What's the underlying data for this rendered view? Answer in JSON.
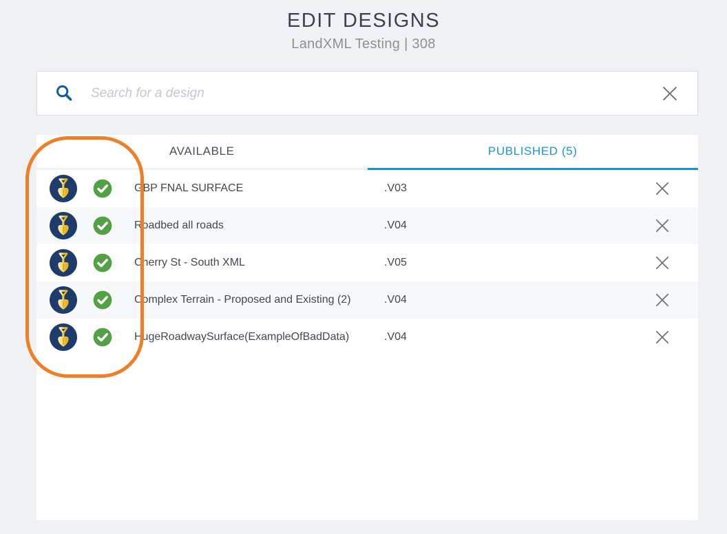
{
  "header": {
    "title": "EDIT DESIGNS",
    "subtitle": "LandXML Testing | 308"
  },
  "search": {
    "placeholder": "Search for a design",
    "value": ""
  },
  "tabs": [
    {
      "label": "AVAILABLE",
      "active": false
    },
    {
      "label": "PUBLISHED (5)",
      "active": true
    }
  ],
  "designs": [
    {
      "name": "GBP FNAL SURFACE",
      "version": ".V03",
      "status": "published"
    },
    {
      "name": "Roadbed all roads",
      "version": ".V04",
      "status": "published"
    },
    {
      "name": "Cherry St - South XML",
      "version": ".V05",
      "status": "published"
    },
    {
      "name": "Complex Terrain - Proposed and Existing (2)",
      "version": ".V04",
      "status": "published"
    },
    {
      "name": "HugeRoadwaySurface(ExampleOfBadData)",
      "version": ".V04",
      "status": "published"
    }
  ],
  "icons": {
    "search": "magnifying-glass",
    "clear_search": "x-mark",
    "design_type": "shovel-circle",
    "published_status": "check-circle",
    "remove_row": "x-mark"
  },
  "colors": {
    "accent_blue": "#1898d6",
    "tab_underline": "#0d97d5",
    "search_icon_blue": "#0d5da2",
    "shovel_circle_navy": "#1e3c6b",
    "shovel_gold": "#eebc2c",
    "check_green": "#52a245",
    "annotation_orange": "#ef7e29",
    "page_background": "#f0f1f5",
    "alt_row_background": "#f7f8fa"
  },
  "annotation": {
    "shape": "rounded-ellipse-outline",
    "color": "#ef7e29",
    "purpose": "highlights the design icon and status column"
  }
}
